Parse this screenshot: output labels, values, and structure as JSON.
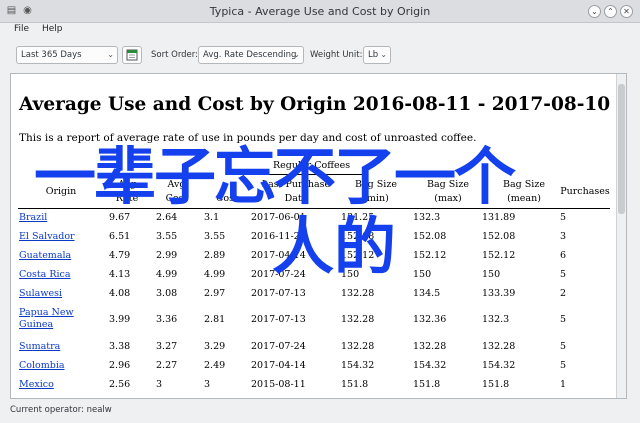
{
  "window": {
    "title": "Typica - Average Use and Cost by Origin"
  },
  "menu": [
    "File",
    "Help"
  ],
  "toolbar": {
    "date_range": "Last 365 Days",
    "sort_label": "Sort Order:",
    "sort_value": "Avg. Rate Descending",
    "weight_label": "Weight Unit:",
    "weight_value": "Lb"
  },
  "report": {
    "title": "Average Use and Cost by Origin 2016-08-11 - 2017-08-10",
    "description": "This is a report of average rate of use in pounds per day and cost of unroasted coffee.",
    "group_header": "Regular Coffees",
    "columns": {
      "origin": "Origin",
      "rate": [
        "Avg",
        "Rate"
      ],
      "avg_cost": [
        "Avg",
        "Cost"
      ],
      "cost": [
        "",
        "Cost"
      ],
      "last_purchase": [
        "Last Purchase",
        "Date"
      ],
      "bag_size_min": [
        "Bag Size",
        "(min)"
      ],
      "bag_size_max": [
        "Bag Size",
        "(max)"
      ],
      "bag_size_mean": [
        "Bag Size",
        "(mean)"
      ],
      "purchases": [
        "Purchases",
        ""
      ]
    },
    "rows": [
      {
        "origin": "Brazil",
        "rate": "9.67",
        "avg_cost": "2.64",
        "cost": "3.1",
        "date": "2017-06-01",
        "min": "131.25",
        "max": "132.3",
        "mean": "131.89",
        "purchases": "5"
      },
      {
        "origin": "El Salvador",
        "rate": "6.51",
        "avg_cost": "3.55",
        "cost": "3.55",
        "date": "2016-11-21",
        "min": "152.08",
        "max": "152.08",
        "mean": "152.08",
        "purchases": "3"
      },
      {
        "origin": "Guatemala",
        "rate": "4.79",
        "avg_cost": "2.99",
        "cost": "2.89",
        "date": "2017-04-14",
        "min": "152.12",
        "max": "152.12",
        "mean": "152.12",
        "purchases": "6"
      },
      {
        "origin": "Costa Rica",
        "rate": "4.13",
        "avg_cost": "4.99",
        "cost": "4.99",
        "date": "2017-07-24",
        "min": "150",
        "max": "150",
        "mean": "150",
        "purchases": "5"
      },
      {
        "origin": "Sulawesi",
        "rate": "4.08",
        "avg_cost": "3.08",
        "cost": "2.97",
        "date": "2017-07-13",
        "min": "132.28",
        "max": "134.5",
        "mean": "133.39",
        "purchases": "2"
      },
      {
        "origin": "Papua New Guinea",
        "rate": "3.99",
        "avg_cost": "3.36",
        "cost": "2.81",
        "date": "2017-07-13",
        "min": "132.28",
        "max": "132.36",
        "mean": "132.3",
        "purchases": "5"
      },
      {
        "origin": "Sumatra",
        "rate": "3.38",
        "avg_cost": "3.27",
        "cost": "3.29",
        "date": "2017-07-24",
        "min": "132.28",
        "max": "132.28",
        "mean": "132.28",
        "purchases": "5"
      },
      {
        "origin": "Colombia",
        "rate": "2.96",
        "avg_cost": "2.27",
        "cost": "2.49",
        "date": "2017-04-14",
        "min": "154.32",
        "max": "154.32",
        "mean": "154.32",
        "purchases": "5"
      },
      {
        "origin": "Mexico",
        "rate": "2.56",
        "avg_cost": "3",
        "cost": "3",
        "date": "2015-08-11",
        "min": "151.8",
        "max": "151.8",
        "mean": "151.8",
        "purchases": "1"
      }
    ]
  },
  "overlay": {
    "line1": "一辈子忘不了一个",
    "line2": "人的"
  },
  "status": {
    "operator": "Current operator: nealw"
  }
}
